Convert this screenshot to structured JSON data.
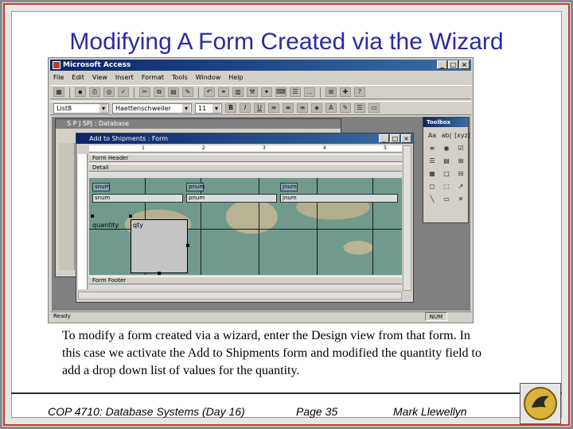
{
  "slide": {
    "title": "Modifying A Form Created via the Wizard",
    "body": "To modify a form created via a wizard, enter the Design view from that form.  In this case we activate the Add to Shipments form and modified the quantity field to add a drop down list of values for the quantity."
  },
  "footer": {
    "course": "COP 4710: Database Systems  (Day 16)",
    "page": "Page 35",
    "author": "Mark Llewellyn"
  },
  "app": {
    "title": "Microsoft Access",
    "menus": [
      "File",
      "Edit",
      "View",
      "Insert",
      "Format",
      "Tools",
      "Window",
      "Help"
    ],
    "object_combo": "List8",
    "font_combo": "Haettenschweiler",
    "size_combo": "11",
    "status_left": "Ready",
    "status_num": "NUM"
  },
  "db_window": {
    "title": "S P J SPJ : Database"
  },
  "form_window": {
    "title": "Add to Shipments : Form",
    "form_header_label": "Form Header",
    "detail_label": "Detail",
    "form_footer_label": "Form Footer",
    "ruler_ticks": [
      "1",
      "2",
      "3",
      "4",
      "5"
    ],
    "labels": [
      "snum",
      "pnum",
      "jnum"
    ],
    "fields": [
      "snum",
      "pnum",
      "jnum"
    ],
    "quantity_label": "quantity",
    "quantity_field": "qty"
  },
  "toolbox": {
    "title": "Toolbox",
    "tools": [
      "Aa",
      "ab|",
      "[xyz]",
      "≡",
      "◉",
      "☑",
      "☰",
      "▤",
      "⊞",
      "▦",
      "□",
      "⊟",
      "◻",
      "⬚",
      "↗",
      "╲",
      "▭",
      "✕"
    ]
  },
  "colors": {
    "title_text": "#2b2ba0",
    "frame_red": "#c0392b",
    "titlebar": "#0a246a"
  }
}
